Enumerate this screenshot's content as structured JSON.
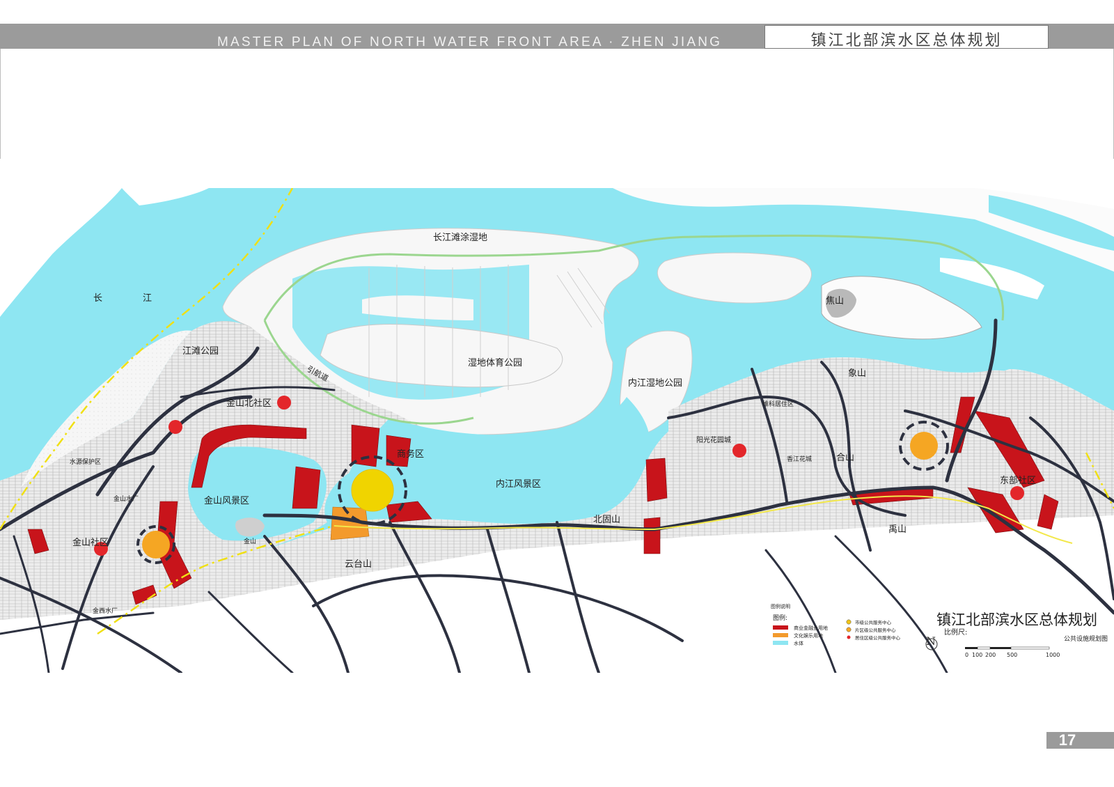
{
  "header": {
    "title_en": "MASTER PLAN OF NORTH WATER FRONT AREA · ZHEN  JIANG",
    "title_cn": "镇江北部滨水区总体规划"
  },
  "map": {
    "labels": {
      "changjiang_chang": "长",
      "changjiang_jiang": "江",
      "wetland_beach": "长江滩涂湿地",
      "jiangtan_park": "江滩公园",
      "channel": "引航道",
      "wetland_sports_park": "湿地体育公园",
      "inner_river_wetland_park": "内江湿地公园",
      "jiaoshan": "焦山",
      "xiangshan": "象山",
      "jinshan_north_community": "金山北社区",
      "water_protection_zone": "水源保护区",
      "jinshan_scenic_area": "金山风景区",
      "jinshan": "金山",
      "jinshan_water_plant": "金山水厂",
      "jinshan_community": "金山社区",
      "jinxi_water_plant": "金西水厂",
      "business_district": "商务区",
      "inner_river_scenic_area": "内江风景区",
      "beiguoshan": "北固山",
      "yuntaishan": "云台山",
      "yangguang_garden": "阳光花园城",
      "weike_residential": "维科居住区",
      "xiangjiang_garden": "香江花城",
      "heshan": "合山",
      "dongbu_community": "东部社区",
      "yushan": "禹山"
    },
    "legend": {
      "small_title": "图例说明",
      "title": "图例:",
      "items": [
        {
          "label": "商业金融业用地",
          "color": "#c8141b"
        },
        {
          "label": "文化娱乐用地",
          "color": "#f39a2c"
        },
        {
          "label": "水体",
          "color": "#8ee6f2"
        }
      ],
      "centers": [
        {
          "label": "市级公共服务中心",
          "color": "#f0c419"
        },
        {
          "label": "片区级公共服务中心",
          "color": "#f5a623"
        },
        {
          "label": "居住区级公共服务中心",
          "color": "#e3262a"
        }
      ]
    },
    "plan_title": "镇江北部滨水区总体规划",
    "plan_subtitle": "公共设施规划图",
    "scale": {
      "label": "比例尺:",
      "ticks": [
        "0",
        "100",
        "200",
        "500",
        "1000"
      ]
    },
    "colors": {
      "water": "#8ee6f2",
      "land": "#ffffff",
      "road": "#2d3140",
      "commercial": "#c8141b",
      "cultural": "#f39a2c",
      "wetland_road": "#9bd68f",
      "railway": "#f0e014"
    }
  },
  "page_number": "17"
}
